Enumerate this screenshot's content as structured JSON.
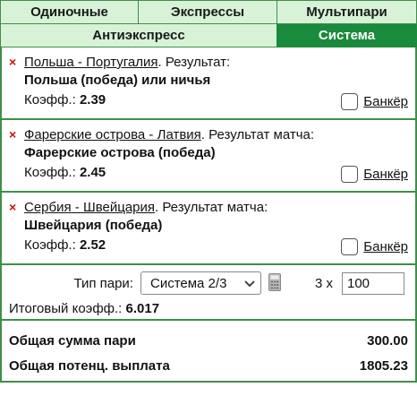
{
  "tabs_row1": [
    {
      "label": "Одиночные",
      "active": false
    },
    {
      "label": "Экспрессы",
      "active": false
    },
    {
      "label": "Мультипари",
      "active": false
    }
  ],
  "tabs_row2": [
    {
      "label": "Антиэкспресс",
      "active": false
    },
    {
      "label": "Система",
      "active": true
    }
  ],
  "bets": [
    {
      "event": "Польша - Португалия",
      "result_label": ". Результат:",
      "outcome": "Польша (победа) или ничья",
      "odds_label": "Коэфф.:",
      "odds": "2.39",
      "banker_label": "Банкёр"
    },
    {
      "event": "Фарерские острова - Латвия",
      "result_label": ". Результат матча:",
      "outcome": "Фарерские острова (победа)",
      "odds_label": "Коэфф.:",
      "odds": "2.45",
      "banker_label": "Банкёр"
    },
    {
      "event": "Сербия - Швейцария",
      "result_label": ". Результат матча:",
      "outcome": "Швейцария (победа)",
      "odds_label": "Коэфф.:",
      "odds": "2.52",
      "banker_label": "Банкёр"
    }
  ],
  "delete_icon": "×",
  "system": {
    "type_label": "Тип пари:",
    "selected": "Система 2/3",
    "multiplier": "3 x",
    "stake": "100",
    "total_odds_label": "Итоговый коэфф.:",
    "total_odds": "6.017"
  },
  "summary": {
    "total_stake_label": "Общая сумма пари",
    "total_stake": "300.00",
    "potential_label": "Общая потенц. выплата",
    "potential": "1805.23"
  },
  "colors": {
    "accent": "#1a8a3c",
    "tab_bg": "#d8f2d8",
    "border": "#3f8f49",
    "delete": "#cc1111"
  }
}
